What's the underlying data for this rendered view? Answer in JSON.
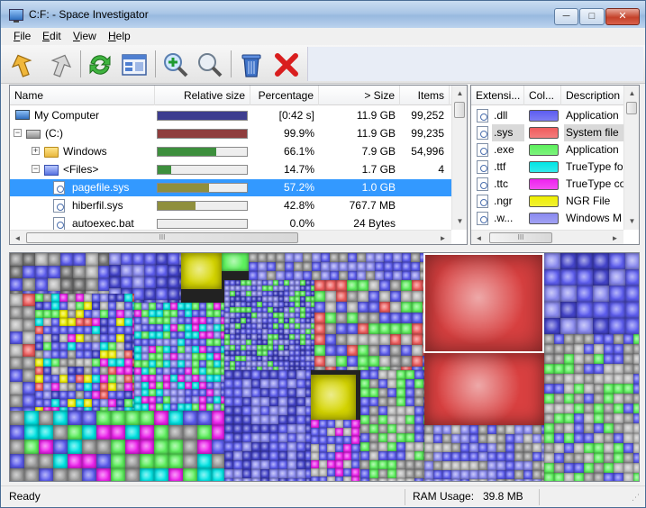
{
  "window": {
    "title": "C:F: - Space Investigator",
    "min_label": "─",
    "max_label": "□",
    "close_label": "✕"
  },
  "menu": [
    {
      "label": "File",
      "accel": "F",
      "rest": "ile"
    },
    {
      "label": "Edit",
      "accel": "E",
      "rest": "dit"
    },
    {
      "label": "View",
      "accel": "V",
      "rest": "iew"
    },
    {
      "label": "Help",
      "accel": "H",
      "rest": "elp"
    }
  ],
  "toolbar": {
    "icons": [
      "back-arrow-icon",
      "forward-arrow-icon",
      "refresh-icon",
      "view-toggle-icon",
      "zoom-in-icon",
      "zoom-out-icon",
      "recycle-bin-icon",
      "delete-icon"
    ]
  },
  "tree": {
    "columns": [
      "Name",
      "Relative size",
      "Percentage",
      "> Size",
      "Items"
    ],
    "rows": [
      {
        "name": "My Computer",
        "percentage": "[0:42 s]",
        "size": "11.9 GB",
        "items": "99,252",
        "fill": 1.0,
        "fill_color": "#3d3d8f",
        "indent": 0,
        "icon": "computer",
        "expander": ""
      },
      {
        "name": "(C:)",
        "percentage": "99.9%",
        "size": "11.9 GB",
        "items": "99,235",
        "fill": 0.999,
        "fill_color": "#8f3d3d",
        "indent": 1,
        "icon": "drive",
        "expander": "−"
      },
      {
        "name": "Windows",
        "percentage": "66.1%",
        "size": "7.9 GB",
        "items": "54,996",
        "fill": 0.661,
        "fill_color": "#3d8f3d",
        "indent": 2,
        "icon": "folder",
        "expander": "+"
      },
      {
        "name": "<Files>",
        "percentage": "14.7%",
        "size": "1.7 GB",
        "items": "4",
        "fill": 0.147,
        "fill_color": "#3d8f3d",
        "indent": 2,
        "icon": "folder-blue",
        "expander": "−"
      },
      {
        "name": "pagefile.sys",
        "percentage": "57.2%",
        "size": "1.0 GB",
        "items": "",
        "fill": 0.572,
        "fill_color": "#8f8f3d",
        "indent": 3,
        "icon": "file",
        "expander": "",
        "selected": true
      },
      {
        "name": "hiberfil.sys",
        "percentage": "42.8%",
        "size": "767.7 MB",
        "items": "",
        "fill": 0.428,
        "fill_color": "#8f8f3d",
        "indent": 3,
        "icon": "file",
        "expander": ""
      },
      {
        "name": "autoexec.bat",
        "percentage": "0.0%",
        "size": "24 Bytes",
        "items": "",
        "fill": 0.0,
        "fill_color": "#8f8f3d",
        "indent": 3,
        "icon": "file",
        "expander": ""
      }
    ]
  },
  "extensions": {
    "columns": [
      "Extensi...",
      "Col...",
      "Description"
    ],
    "rows": [
      {
        "ext": ".dll",
        "color": "#5d5df0",
        "description": "Application"
      },
      {
        "ext": ".sys",
        "color": "#f05d5d",
        "description": "System file",
        "selected": true
      },
      {
        "ext": ".exe",
        "color": "#5df05d",
        "description": "Application"
      },
      {
        "ext": ".ttf",
        "color": "#00e5e5",
        "description": "TrueType fo"
      },
      {
        "ext": ".ttc",
        "color": "#ee22ee",
        "description": "TrueType co"
      },
      {
        "ext": ".ngr",
        "color": "#eeee00",
        "description": "NGR File"
      },
      {
        "ext": ".w...",
        "color": "#8a8af0",
        "description": "Windows M"
      }
    ]
  },
  "scroll": {
    "hthumb_label": "III",
    "up": "▲",
    "down": "▼",
    "left": "◄",
    "right": "►"
  },
  "status": {
    "ready": "Ready",
    "ram_label": "RAM Usage:",
    "ram_value": "39.8 MB"
  }
}
